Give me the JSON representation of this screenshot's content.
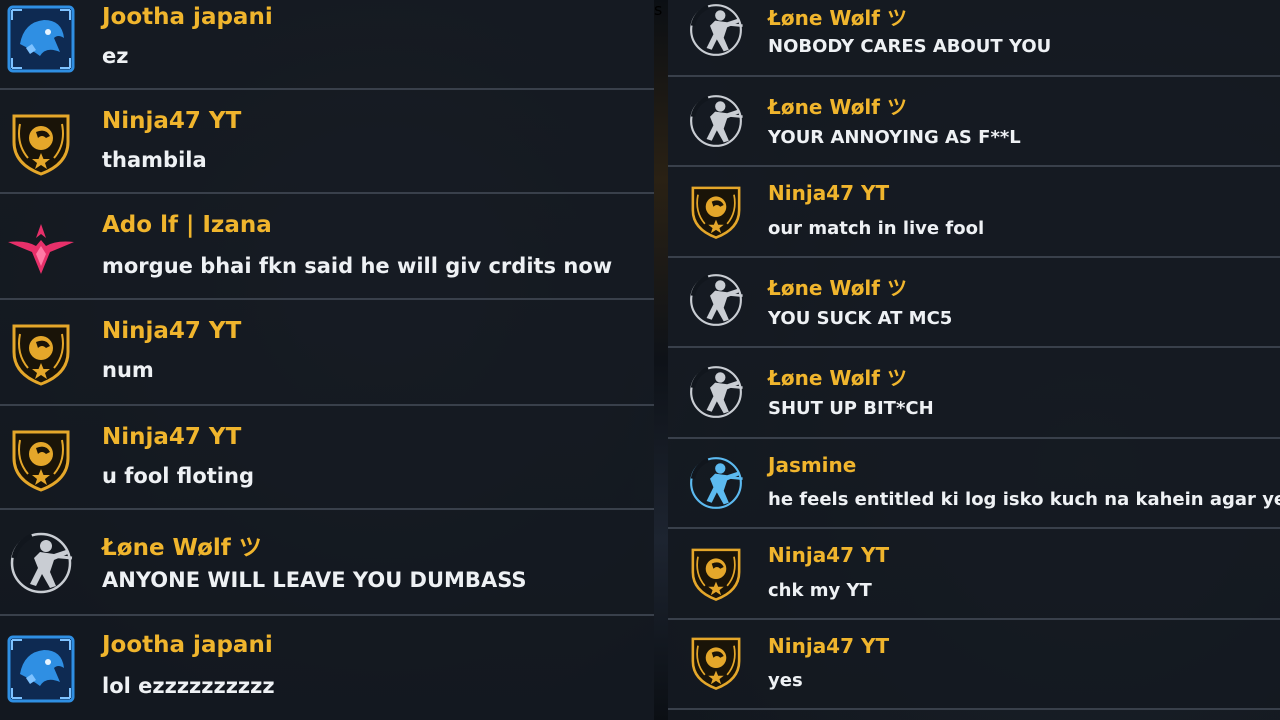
{
  "left_chat": {
    "messages": [
      {
        "sender": "Jootha japani",
        "text": "ez",
        "icon": "blue-beast-emblem-icon"
      },
      {
        "sender": "Ninja47 YT",
        "text": "thambila",
        "icon": "gold-eagle-shield-icon"
      },
      {
        "sender": "Ado lf | Izana",
        "text": "morgue bhai fkn said he will giv crdits now",
        "icon": "pink-winged-emblem-icon"
      },
      {
        "sender": "Ninja47 YT",
        "text": "num",
        "icon": "gold-eagle-shield-icon"
      },
      {
        "sender": "Ninja47 YT",
        "text": "u fool floting",
        "icon": "gold-eagle-shield-icon"
      },
      {
        "sender": "Łøne Wølf ツ",
        "text": "ANYONE WILL LEAVE YOU DUMBASS",
        "icon": "silver-soldier-emblem-icon"
      },
      {
        "sender": "Jootha japani",
        "text": "lol ezzzzzzzzzz",
        "icon": "blue-beast-emblem-icon"
      }
    ]
  },
  "right_chat": {
    "messages": [
      {
        "sender": "Łøne Wølf ツ",
        "text": "NOBODY CARES ABOUT YOU",
        "icon": "silver-soldier-emblem-icon"
      },
      {
        "sender": "Łøne Wølf ツ",
        "text": "YOUR ANNOYING AS F**L",
        "icon": "silver-soldier-emblem-icon"
      },
      {
        "sender": "Ninja47 YT",
        "text": "our match in live fool",
        "icon": "gold-eagle-shield-icon"
      },
      {
        "sender": "Łøne Wølf ツ",
        "text": "YOU SUCK AT MC5",
        "icon": "silver-soldier-emblem-icon"
      },
      {
        "sender": "Łøne Wølf ツ",
        "text": "SHUT UP BIT*CH",
        "icon": "silver-soldier-emblem-icon"
      },
      {
        "sender": "Jasmine",
        "text": "he feels entitled ki log isko kuch na kahein agar ye",
        "icon": "blue-soldier-emblem-icon"
      },
      {
        "sender": "Ninja47 YT",
        "text": "chk my YT",
        "icon": "gold-eagle-shield-icon"
      },
      {
        "sender": "Ninja47 YT",
        "text": "yes",
        "icon": "gold-eagle-shield-icon"
      }
    ]
  },
  "seam_glyph": "s",
  "colors": {
    "sender_name": "#f0b52d",
    "message_text": "#eef1f4",
    "row_divider": "#39404b",
    "gold_emblem": "#e5a72a",
    "blue_emblem": "#2f8fe3",
    "pink_emblem": "#e8306a",
    "silver_emblem": "#c9cdd3",
    "light_blue_emblem": "#5cbaf0"
  }
}
